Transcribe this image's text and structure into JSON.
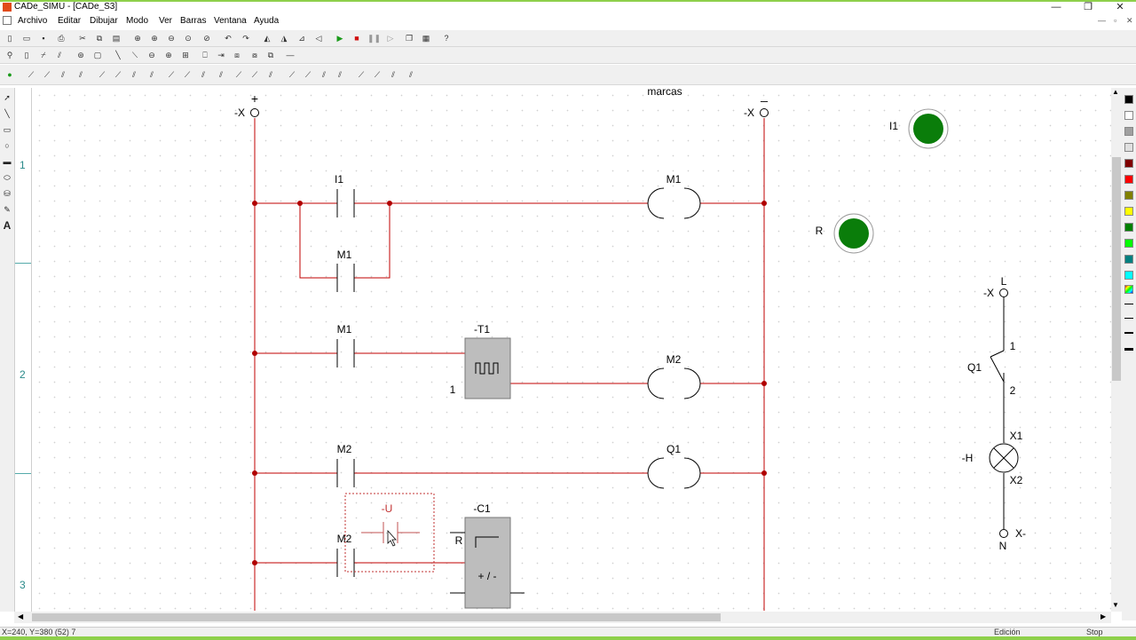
{
  "window": {
    "title": "CADe_SIMU - [CADe_S3]"
  },
  "menu": [
    "Archivo",
    "Editar",
    "Dibujar",
    "Modo",
    "Ver",
    "Barras",
    "Ventana",
    "Ayuda"
  ],
  "ruler": {
    "rows": [
      "1",
      "2",
      "3"
    ]
  },
  "diagram": {
    "title": "marcas",
    "plus_sign": "+",
    "minus_sign": "_",
    "left_terminal": "-X",
    "right_terminal": "-X",
    "contacts": [
      "I1",
      "M1",
      "M1",
      "M2",
      "M2"
    ],
    "coils": [
      "M1",
      "M2",
      "Q1"
    ],
    "timer": {
      "label": "-T1",
      "preset": "1"
    },
    "counter": {
      "label": "-C1",
      "reset": "R",
      "updown": "+ / -"
    },
    "ghost_contact": "-U"
  },
  "indicators": [
    {
      "label": "I1",
      "color": "#0a7d0a"
    },
    {
      "label": "R",
      "color": "#0a7d0a"
    }
  ],
  "power_circuit": {
    "top_terminal": "-X",
    "top_label": "L",
    "switch": "Q1",
    "switch_pin1": "1",
    "switch_pin2": "2",
    "lamp": "-H",
    "lamp_pin1": "X1",
    "lamp_pin2": "X2",
    "bottom_terminal": "X-",
    "bottom_label": "N"
  },
  "status": {
    "coords": "X=240, Y=380 (52) 7",
    "mode": "Edición",
    "state": "Stop"
  },
  "colors": {
    "wire": "#c00000",
    "node": "#b00000",
    "accent": "#8ed04b",
    "indicator": "#0a7d0a"
  }
}
